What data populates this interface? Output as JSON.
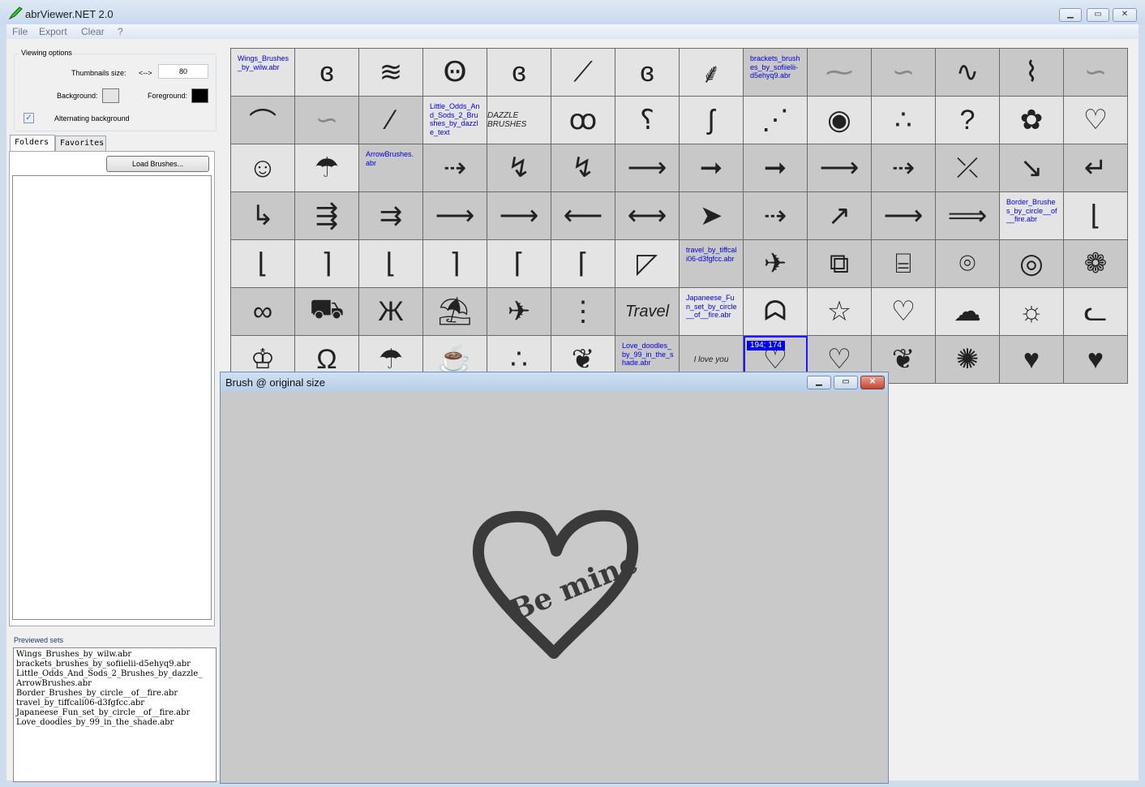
{
  "window": {
    "title": "abrViewer.NET 2.0",
    "minimize": "▁",
    "maximize": "▭",
    "close": "✕"
  },
  "menu": [
    "File",
    "Export",
    "Clear",
    "?"
  ],
  "viewing_options": {
    "title": "Viewing options",
    "thumb_label": "Thumbnails size:",
    "thumb_arrows": "<-->",
    "thumb_value": "80",
    "background_label": "Background:",
    "background_color": "#e4e4e4",
    "foreground_label": "Foreground:",
    "foreground_color": "#000000",
    "alternating_label": "Alternating background",
    "alternating_checked": true
  },
  "tabs": [
    "Folders",
    "Favorites"
  ],
  "load_button": "Load Brushes...",
  "previewed": {
    "title": "Previewed sets",
    "items": [
      "Wings_Brushes_by_wilw.abr",
      "brackets_brushes_by_sofiielii-d5ehyq9.abr",
      "Little_Odds_And_Sods_2_Brushes_by_dazzle_",
      "ArrowBrushes.abr",
      "Border_Brushes_by_circle__of__fire.abr",
      "travel_by_tiffcali06-d3fgfcc.abr",
      "Japaneese_Fun_set_by_circle__of__fire.abr",
      "Love_doodles_by_99_in_the_shade.abr"
    ]
  },
  "grid": {
    "cells": [
      {
        "set": "Wings_Brushes_by_wilw.abr",
        "bg": "light"
      },
      {
        "icon": "wing",
        "g": "ɞ",
        "bg": "light"
      },
      {
        "icon": "wing",
        "g": "≋",
        "bg": "light"
      },
      {
        "icon": "wing",
        "g": "Ꙫ",
        "bg": "light"
      },
      {
        "icon": "wing",
        "g": "ɞ",
        "bg": "light"
      },
      {
        "icon": "wing",
        "g": "⟋",
        "bg": "light"
      },
      {
        "icon": "wing",
        "g": "ɞ",
        "bg": "light"
      },
      {
        "icon": "wing",
        "g": "⸙",
        "bg": "light"
      },
      {
        "set": "brackets_brushes_by_sofiielii-d5ehyq9.abr",
        "bg": "dark"
      },
      {
        "icon": "bracket",
        "g": "⁓",
        "bg": "dark",
        "faint": true
      },
      {
        "icon": "bracket",
        "g": "∽",
        "bg": "dark",
        "faint": true
      },
      {
        "icon": "bracket",
        "g": "∿",
        "bg": "dark"
      },
      {
        "icon": "bracket",
        "g": "⌇",
        "bg": "dark"
      },
      {
        "icon": "bracket",
        "g": "∽",
        "bg": "dark",
        "faint": true
      },
      {
        "icon": "bracket",
        "g": "⌒",
        "bg": "dark"
      },
      {
        "icon": "bracket",
        "g": "∽",
        "bg": "dark",
        "faint": true
      },
      {
        "icon": "bracket",
        "g": "⁄",
        "bg": "dark"
      },
      {
        "set": "Little_Odds_And_Sods_2_Brushes_by_dazzle_text",
        "bg": "light"
      },
      {
        "icon": "dazzle-text",
        "g": "DAZZLE BRUSHES",
        "bg": "light",
        "small": true
      },
      {
        "icon": "bird",
        "g": "ꝏ",
        "bg": "light"
      },
      {
        "icon": "candy-cane",
        "g": "⸮",
        "bg": "light"
      },
      {
        "icon": "hook",
        "g": "ʃ",
        "bg": "light"
      },
      {
        "icon": "bee-trail",
        "g": "⋰",
        "bg": "light"
      },
      {
        "icon": "eye",
        "g": "◉",
        "bg": "light"
      },
      {
        "icon": "drops",
        "g": "∴",
        "bg": "light"
      },
      {
        "icon": "question",
        "g": "?",
        "bg": "light"
      },
      {
        "icon": "bee",
        "g": "✿",
        "bg": "light"
      },
      {
        "icon": "broken-heart",
        "g": "♡",
        "bg": "light"
      },
      {
        "icon": "face",
        "g": "☺",
        "bg": "light"
      },
      {
        "icon": "umbrella",
        "g": "☂",
        "bg": "light"
      },
      {
        "set": "ArrowBrushes.abr",
        "bg": "dark"
      },
      {
        "icon": "arrow",
        "g": "⇢",
        "bg": "dark"
      },
      {
        "icon": "arrow",
        "g": "↯",
        "bg": "dark"
      },
      {
        "icon": "arrow",
        "g": "↯",
        "bg": "dark"
      },
      {
        "icon": "arrow",
        "g": "⟶",
        "bg": "dark"
      },
      {
        "icon": "arrow",
        "g": "➞",
        "bg": "dark"
      },
      {
        "icon": "arrow",
        "g": "➞",
        "bg": "dark"
      },
      {
        "icon": "arrow",
        "g": "⟶",
        "bg": "dark"
      },
      {
        "icon": "arrow",
        "g": "⇢",
        "bg": "dark"
      },
      {
        "icon": "arrow",
        "g": "⤫",
        "bg": "dark"
      },
      {
        "icon": "arrow",
        "g": "↘",
        "bg": "dark"
      },
      {
        "icon": "arrow",
        "g": "↵",
        "bg": "dark"
      },
      {
        "icon": "arrow",
        "g": "↳",
        "bg": "dark"
      },
      {
        "icon": "arrow",
        "g": "⇶",
        "bg": "dark"
      },
      {
        "icon": "arrow",
        "g": "⇉",
        "bg": "dark"
      },
      {
        "icon": "arrow",
        "g": "⟶",
        "bg": "dark"
      },
      {
        "icon": "arrow",
        "g": "⟶",
        "bg": "dark"
      },
      {
        "icon": "arrow",
        "g": "⟵",
        "bg": "dark"
      },
      {
        "icon": "arrow",
        "g": "⟷",
        "bg": "dark"
      },
      {
        "icon": "arrow",
        "g": "➤",
        "bg": "dark"
      },
      {
        "icon": "arrow",
        "g": "⇢",
        "bg": "dark"
      },
      {
        "icon": "arrow",
        "g": "↗",
        "bg": "dark"
      },
      {
        "icon": "arrow",
        "g": "⟶",
        "bg": "dark"
      },
      {
        "icon": "arrow",
        "g": "⟹",
        "bg": "dark"
      },
      {
        "set": "Border_Brushes_by_circle__of__fire.abr",
        "bg": "light"
      },
      {
        "icon": "border",
        "g": "⌊",
        "bg": "light"
      },
      {
        "icon": "border",
        "g": "⌊",
        "bg": "light"
      },
      {
        "icon": "border",
        "g": "⌉",
        "bg": "light"
      },
      {
        "icon": "border",
        "g": "⌊",
        "bg": "light"
      },
      {
        "icon": "border",
        "g": "⌉",
        "bg": "light"
      },
      {
        "icon": "border",
        "g": "⌈",
        "bg": "light"
      },
      {
        "icon": "border",
        "g": "⌈",
        "bg": "light"
      },
      {
        "icon": "border",
        "g": "◸",
        "bg": "light"
      },
      {
        "set": "travel_by_tiffcali06-d3fgfcc.abr",
        "bg": "dark"
      },
      {
        "icon": "airplane",
        "g": "✈",
        "bg": "dark"
      },
      {
        "icon": "flip-flops",
        "g": "⧉",
        "bg": "dark"
      },
      {
        "icon": "luggage",
        "g": "⌸",
        "bg": "dark"
      },
      {
        "icon": "camera",
        "g": "⌾",
        "bg": "dark"
      },
      {
        "icon": "compass",
        "g": "◎",
        "bg": "dark"
      },
      {
        "icon": "map",
        "g": "❁",
        "bg": "dark"
      },
      {
        "icon": "sunglasses",
        "g": "∞",
        "bg": "dark"
      },
      {
        "icon": "car",
        "g": "⛟",
        "bg": "dark"
      },
      {
        "icon": "butterfly",
        "g": "Ж",
        "bg": "dark"
      },
      {
        "icon": "beach-umbrella",
        "g": "⛱",
        "bg": "dark"
      },
      {
        "icon": "airplane",
        "g": "✈",
        "bg": "dark"
      },
      {
        "icon": "cheap-flights",
        "g": "⋮",
        "bg": "dark"
      },
      {
        "icon": "travel-text",
        "g": "Travel",
        "bg": "dark",
        "small": true
      },
      {
        "set": "Japaneese_Fun_set_by_circle__of__fire.abr",
        "bg": "light"
      },
      {
        "icon": "ghost",
        "g": "ᗣ",
        "bg": "light"
      },
      {
        "icon": "star",
        "g": "☆",
        "bg": "light"
      },
      {
        "icon": "heart",
        "g": "♡",
        "bg": "light"
      },
      {
        "icon": "cloud",
        "g": "☁",
        "bg": "light"
      },
      {
        "icon": "sun",
        "g": "☼",
        "bg": "light"
      },
      {
        "icon": "cat",
        "g": "ᓚ",
        "bg": "light"
      },
      {
        "icon": "crown",
        "g": "♔",
        "bg": "light"
      },
      {
        "icon": "dog",
        "g": "Ω",
        "bg": "light"
      },
      {
        "icon": "umbrella",
        "g": "☂",
        "bg": "light"
      },
      {
        "icon": "cup",
        "g": "☕",
        "bg": "light"
      },
      {
        "icon": "paw",
        "g": "∴",
        "bg": "light"
      },
      {
        "icon": "leaves",
        "g": "❦",
        "bg": "light"
      },
      {
        "set": "Love_doodles_by_99_in_the_shade.abr",
        "bg": "dark"
      },
      {
        "icon": "i-love-you",
        "g": "I love you",
        "bg": "dark",
        "small": true
      },
      {
        "icon": "heart-be-mine",
        "g": "♡",
        "bg": "dark",
        "selected": true,
        "badge": "194; 174"
      },
      {
        "icon": "heart",
        "g": "♡",
        "bg": "dark"
      },
      {
        "icon": "heart-burst",
        "g": "❦",
        "bg": "dark"
      },
      {
        "icon": "heart-burst",
        "g": "✺",
        "bg": "dark"
      },
      {
        "icon": "heart",
        "g": "♥",
        "bg": "dark"
      },
      {
        "icon": "heart",
        "g": "♥",
        "bg": "dark"
      }
    ]
  },
  "preview": {
    "title": "Brush @ original size",
    "brush_text": "Be mine",
    "minimize": "▁",
    "maximize": "▭",
    "close": "✕"
  }
}
